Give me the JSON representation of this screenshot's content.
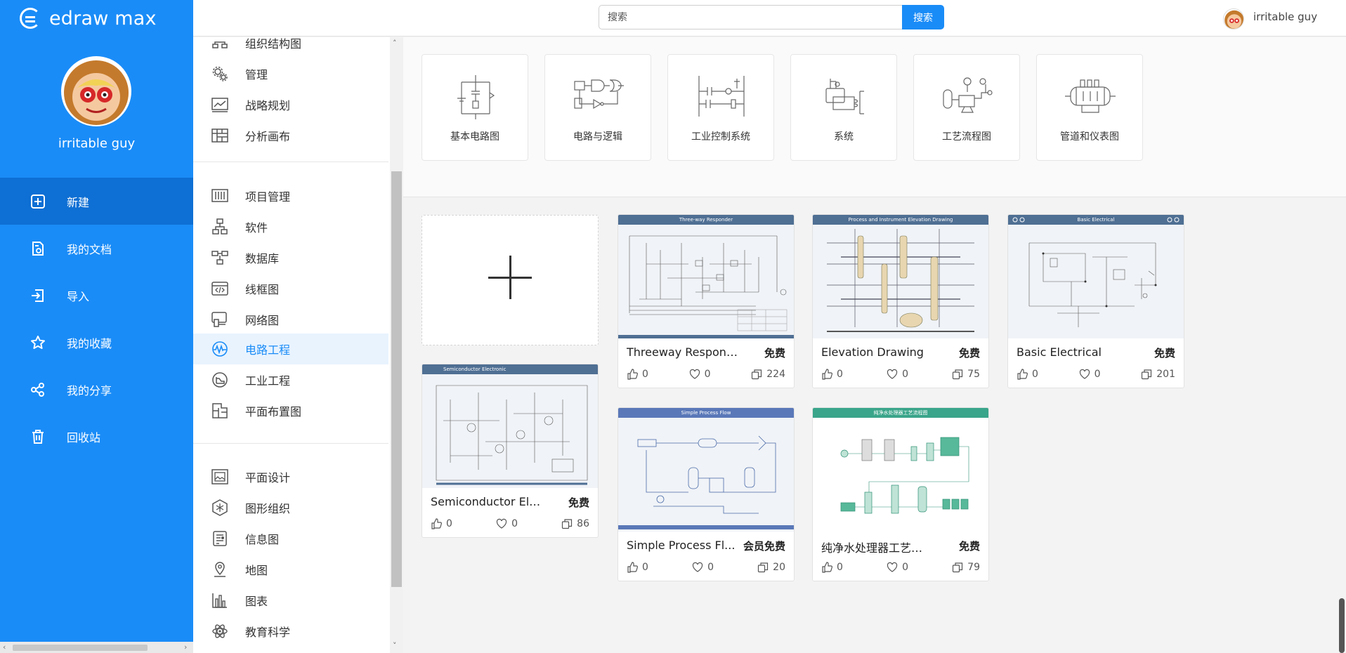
{
  "app": {
    "logo_text": "edraw max",
    "brand_color": "#1a8cf7"
  },
  "user": {
    "name": "irritable guy"
  },
  "nav": [
    {
      "label": "新建",
      "icon": "plus-square-icon",
      "active": true
    },
    {
      "label": "我的文档",
      "icon": "document-icon"
    },
    {
      "label": "导入",
      "icon": "import-icon"
    },
    {
      "label": "我的收藏",
      "icon": "star-icon"
    },
    {
      "label": "我的分享",
      "icon": "share-icon"
    },
    {
      "label": "回收站",
      "icon": "trash-icon"
    }
  ],
  "search": {
    "placeholder": "搜索",
    "button": "搜索"
  },
  "categories": {
    "group1": [
      {
        "label": "组织结构图",
        "icon": "org-chart-icon"
      },
      {
        "label": "管理",
        "icon": "gears-icon"
      },
      {
        "label": "战略规划",
        "icon": "line-chart-icon"
      },
      {
        "label": "分析画布",
        "icon": "canvas-grid-icon"
      }
    ],
    "group2": [
      {
        "label": "项目管理",
        "icon": "project-icon"
      },
      {
        "label": "软件",
        "icon": "software-icon"
      },
      {
        "label": "数据库",
        "icon": "database-icon"
      },
      {
        "label": "线框图",
        "icon": "wireframe-icon"
      },
      {
        "label": "网络图",
        "icon": "network-icon"
      },
      {
        "label": "电路工程",
        "icon": "circuit-icon",
        "active": true
      },
      {
        "label": "工业工程",
        "icon": "industrial-icon"
      },
      {
        "label": "平面布置图",
        "icon": "floorplan-icon"
      }
    ],
    "group3": [
      {
        "label": "平面设计",
        "icon": "graphic-design-icon"
      },
      {
        "label": "图形组织",
        "icon": "graphic-organizer-icon"
      },
      {
        "label": "信息图",
        "icon": "infographic-icon"
      },
      {
        "label": "地图",
        "icon": "map-pin-icon"
      },
      {
        "label": "图表",
        "icon": "bar-chart-icon"
      },
      {
        "label": "教育科学",
        "icon": "atom-icon"
      }
    ]
  },
  "subcategories": [
    {
      "label": "基本电路图"
    },
    {
      "label": "电路与逻辑"
    },
    {
      "label": "工业控制系统"
    },
    {
      "label": "系统"
    },
    {
      "label": "工艺流程图"
    },
    {
      "label": "管道和仪表图"
    }
  ],
  "templates": [
    {
      "title": "Threeway Responder",
      "badge": "免费",
      "likes": "0",
      "favs": "0",
      "copies": "224",
      "header": "Three-way Responder",
      "header_color": "#4f6f93"
    },
    {
      "title": "Elevation Drawing",
      "badge": "免费",
      "likes": "0",
      "favs": "0",
      "copies": "75",
      "header": "Process and Instrument Elevation Drawing",
      "header_color": "#4f6f93"
    },
    {
      "title": "Basic Electrical",
      "badge": "免费",
      "likes": "0",
      "favs": "0",
      "copies": "201",
      "header": "Basic Electrical",
      "header_color": "#4f6f93"
    },
    {
      "title": "Semiconductor Electr...",
      "badge": "免费",
      "likes": "0",
      "favs": "0",
      "copies": "86",
      "header": "Semiconductor Electronic",
      "header_color": "#4f6f93"
    },
    {
      "title": "Simple Process Fl...",
      "badge": "会员免费",
      "likes": "0",
      "favs": "0",
      "copies": "20",
      "header": "Simple Process Flow",
      "header_color": "#5a78b8"
    },
    {
      "title": "纯净水处理器工艺流程图",
      "badge": "免费",
      "likes": "0",
      "favs": "0",
      "copies": "79",
      "header": "纯净水处理器工艺流程图",
      "header_color": "#3aa58a"
    }
  ]
}
